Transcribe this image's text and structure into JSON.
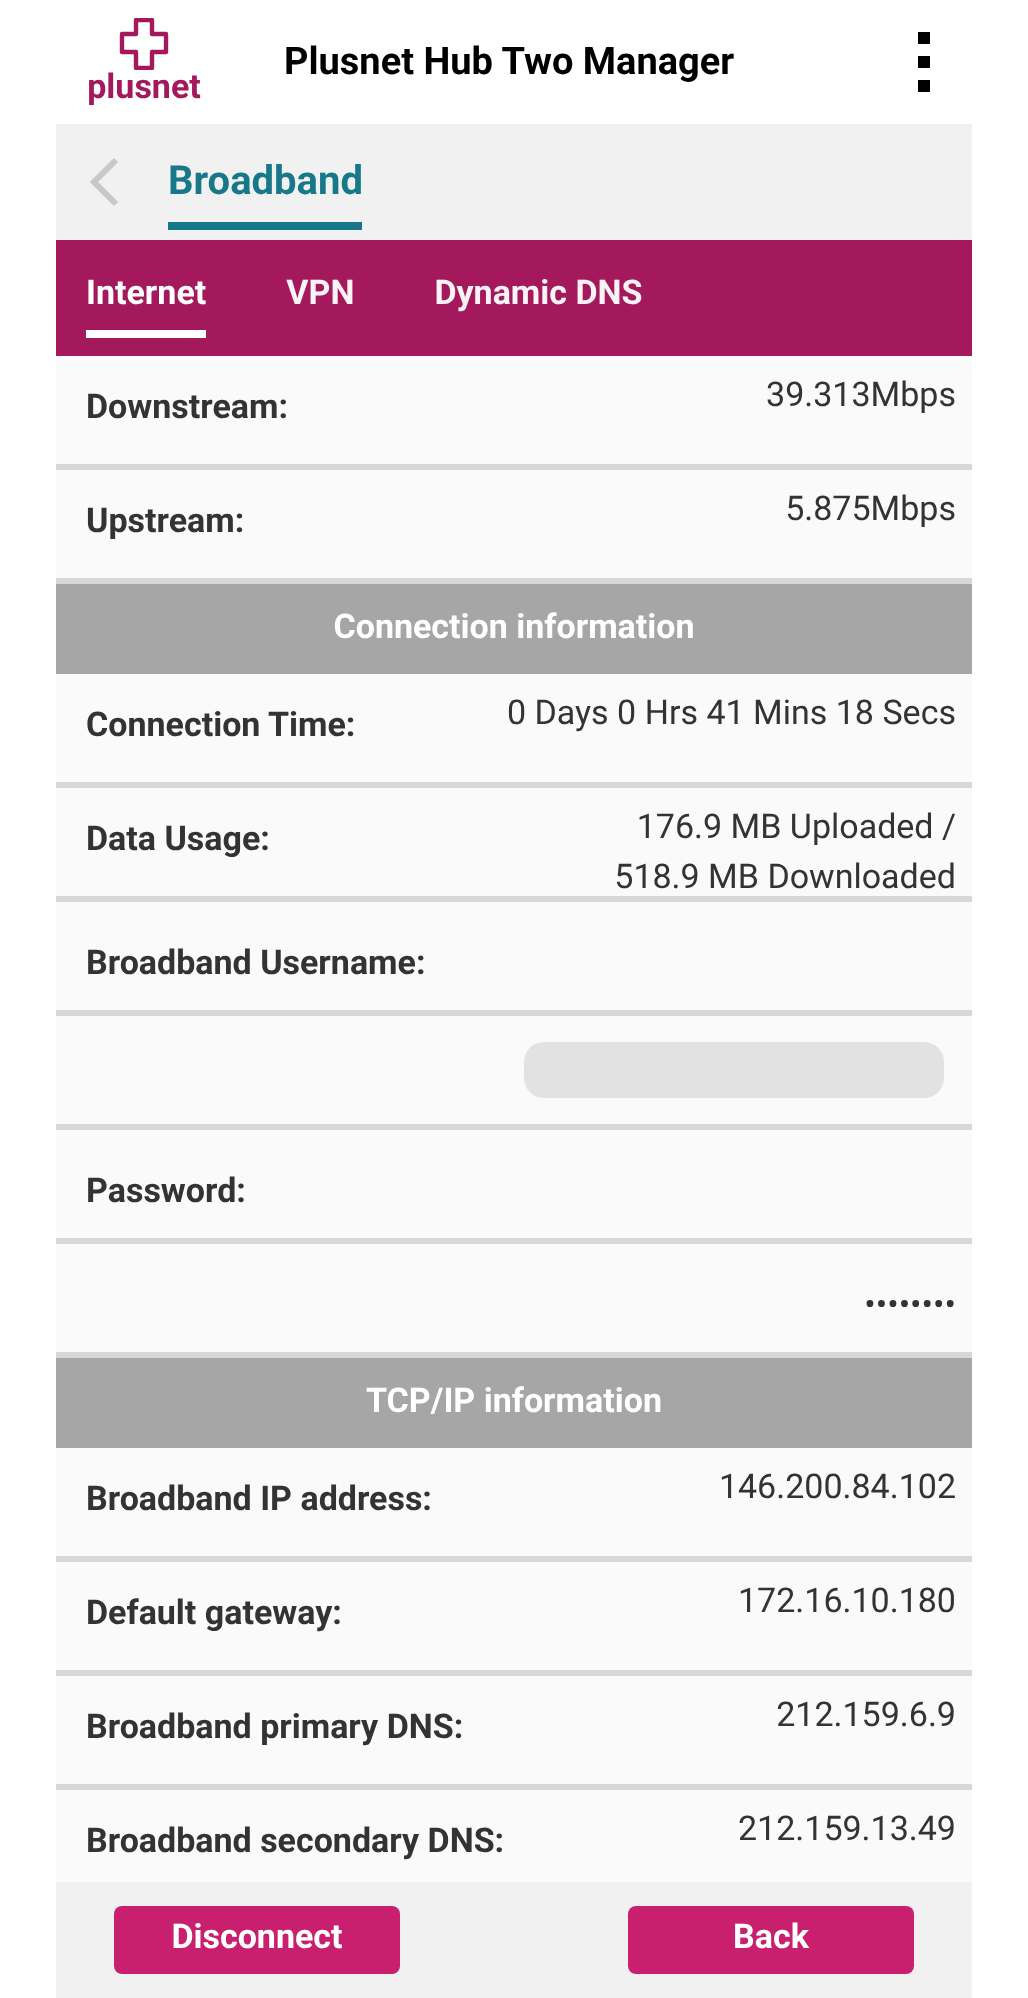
{
  "app_bar": {
    "logo_text": "plusnet",
    "title": "Plusnet Hub Two Manager"
  },
  "breadcrumb": {
    "title": "Broadband"
  },
  "tabs": [
    {
      "label": "Internet",
      "selected": true
    },
    {
      "label": "VPN",
      "selected": false
    },
    {
      "label": "Dynamic DNS",
      "selected": false
    }
  ],
  "rows": [
    {
      "kind": "pair",
      "label": "Downstream:",
      "value": "39.313Mbps"
    },
    {
      "kind": "pair",
      "label": "Upstream:",
      "value": "5.875Mbps"
    },
    {
      "kind": "section",
      "label": "Connection information"
    },
    {
      "kind": "pair",
      "label": "Connection Time:",
      "value": "0 Days 0 Hrs 41 Mins 18 Secs"
    },
    {
      "kind": "pair",
      "label": "Data Usage:",
      "value": "176.9 MB Uploaded / 518.9 MB Downloaded"
    },
    {
      "kind": "label",
      "label": "Broadband Username:"
    },
    {
      "kind": "redacted"
    },
    {
      "kind": "label",
      "label": "Password:"
    },
    {
      "kind": "value",
      "value": "••••••••"
    },
    {
      "kind": "section",
      "label": "TCP/IP information"
    },
    {
      "kind": "pair",
      "label": "Broadband IP address:",
      "value": "146.200.84.102"
    },
    {
      "kind": "pair",
      "label": "Default gateway:",
      "value": "172.16.10.180"
    },
    {
      "kind": "pair",
      "label": "Broadband primary DNS:",
      "value": "212.159.6.9"
    },
    {
      "kind": "pair",
      "label": "Broadband secondary DNS:",
      "value": "212.159.13.49"
    }
  ],
  "buttons": [
    "Disconnect",
    "Back"
  ]
}
